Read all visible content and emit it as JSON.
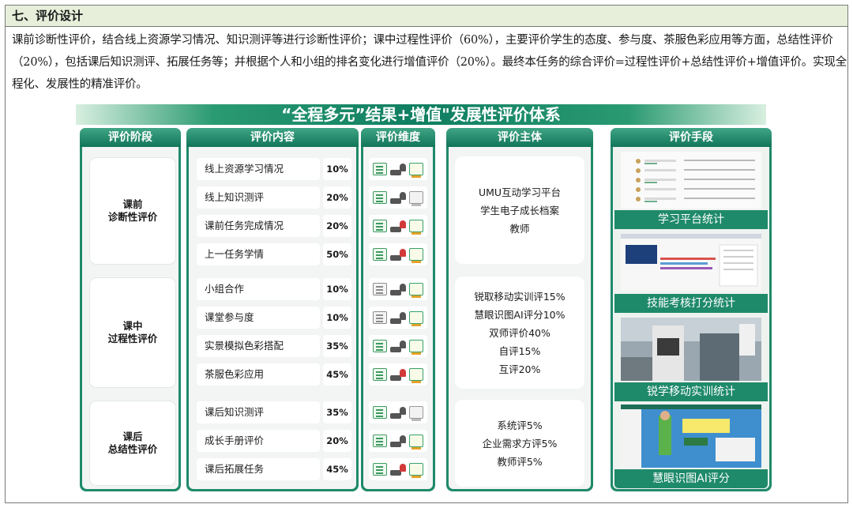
{
  "section": {
    "heading": "七、评价设计",
    "paragraph": "课前诊断性评价，结合线上资源学习情况、知识测评等进行诊断性评价；课中过程性评价（60%），主要评价学生的态度、参与度、茶服色彩应用等方面，总结性评价（20%），包括课后知识测评、拓展任务等；并根据个人和小组的排名变化进行增值评价（20%）。最终本任务的综合评价=过程性评价+总结性评价+增值评价。实现全程化、发展性的精准评价。"
  },
  "figure": {
    "title": "“全程多元”结果+增值\"发展性评价体系",
    "headers": {
      "stage": "评价阶段",
      "content": "评价内容",
      "dimension": "评价维度",
      "subject": "评价主体",
      "means": "评价手段"
    },
    "stages": [
      {
        "label": "课前\n诊断性评价",
        "items": [
          {
            "name": "线上资源学习情况",
            "pct": "10%",
            "icons": [
              "doc",
              "people",
              "board"
            ]
          },
          {
            "name": "线上知识测评",
            "pct": "20%",
            "icons": [
              "doc",
              "people",
              "board-grey"
            ]
          },
          {
            "name": "课前任务完成情况",
            "pct": "20%",
            "icons": [
              "doc",
              "people-red",
              "board"
            ]
          },
          {
            "name": "上一任务学情",
            "pct": "50%",
            "icons": [
              "doc",
              "people-red",
              "board"
            ]
          }
        ],
        "subjects": [
          "UMU互动学习平台",
          "学生电子成长档案",
          "教师"
        ]
      },
      {
        "label": "课中\n过程性评价",
        "items": [
          {
            "name": "小组合作",
            "pct": "10%",
            "icons": [
              "doc-grey",
              "people",
              "board"
            ]
          },
          {
            "name": "课堂参与度",
            "pct": "10%",
            "icons": [
              "doc-grey",
              "people",
              "board"
            ]
          },
          {
            "name": "实景模拟色彩搭配",
            "pct": "35%",
            "icons": [
              "doc",
              "people",
              "board"
            ]
          },
          {
            "name": "茶服色彩应用",
            "pct": "45%",
            "icons": [
              "doc",
              "people-red",
              "board"
            ]
          }
        ],
        "subjects": [
          "锐取移动实训评15%",
          "慧眼识图AI评分10%",
          "双师评价40%",
          "自评15%",
          "互评20%"
        ]
      },
      {
        "label": "课后\n总结性评价",
        "items": [
          {
            "name": "课后知识测评",
            "pct": "35%",
            "icons": [
              "doc",
              "people",
              "board-grey"
            ]
          },
          {
            "name": "成长手册评价",
            "pct": "20%",
            "icons": [
              "doc",
              "people",
              "board"
            ]
          },
          {
            "name": "课后拓展任务",
            "pct": "45%",
            "icons": [
              "doc",
              "people-red",
              "board"
            ]
          }
        ],
        "subjects": [
          "系统评5%",
          "企业需求方评5%",
          "教师评5%"
        ]
      }
    ],
    "means": [
      "学习平台统计",
      "技能考核打分统计",
      "锐学移动实训统计",
      "慧眼识图AI评分"
    ]
  }
}
